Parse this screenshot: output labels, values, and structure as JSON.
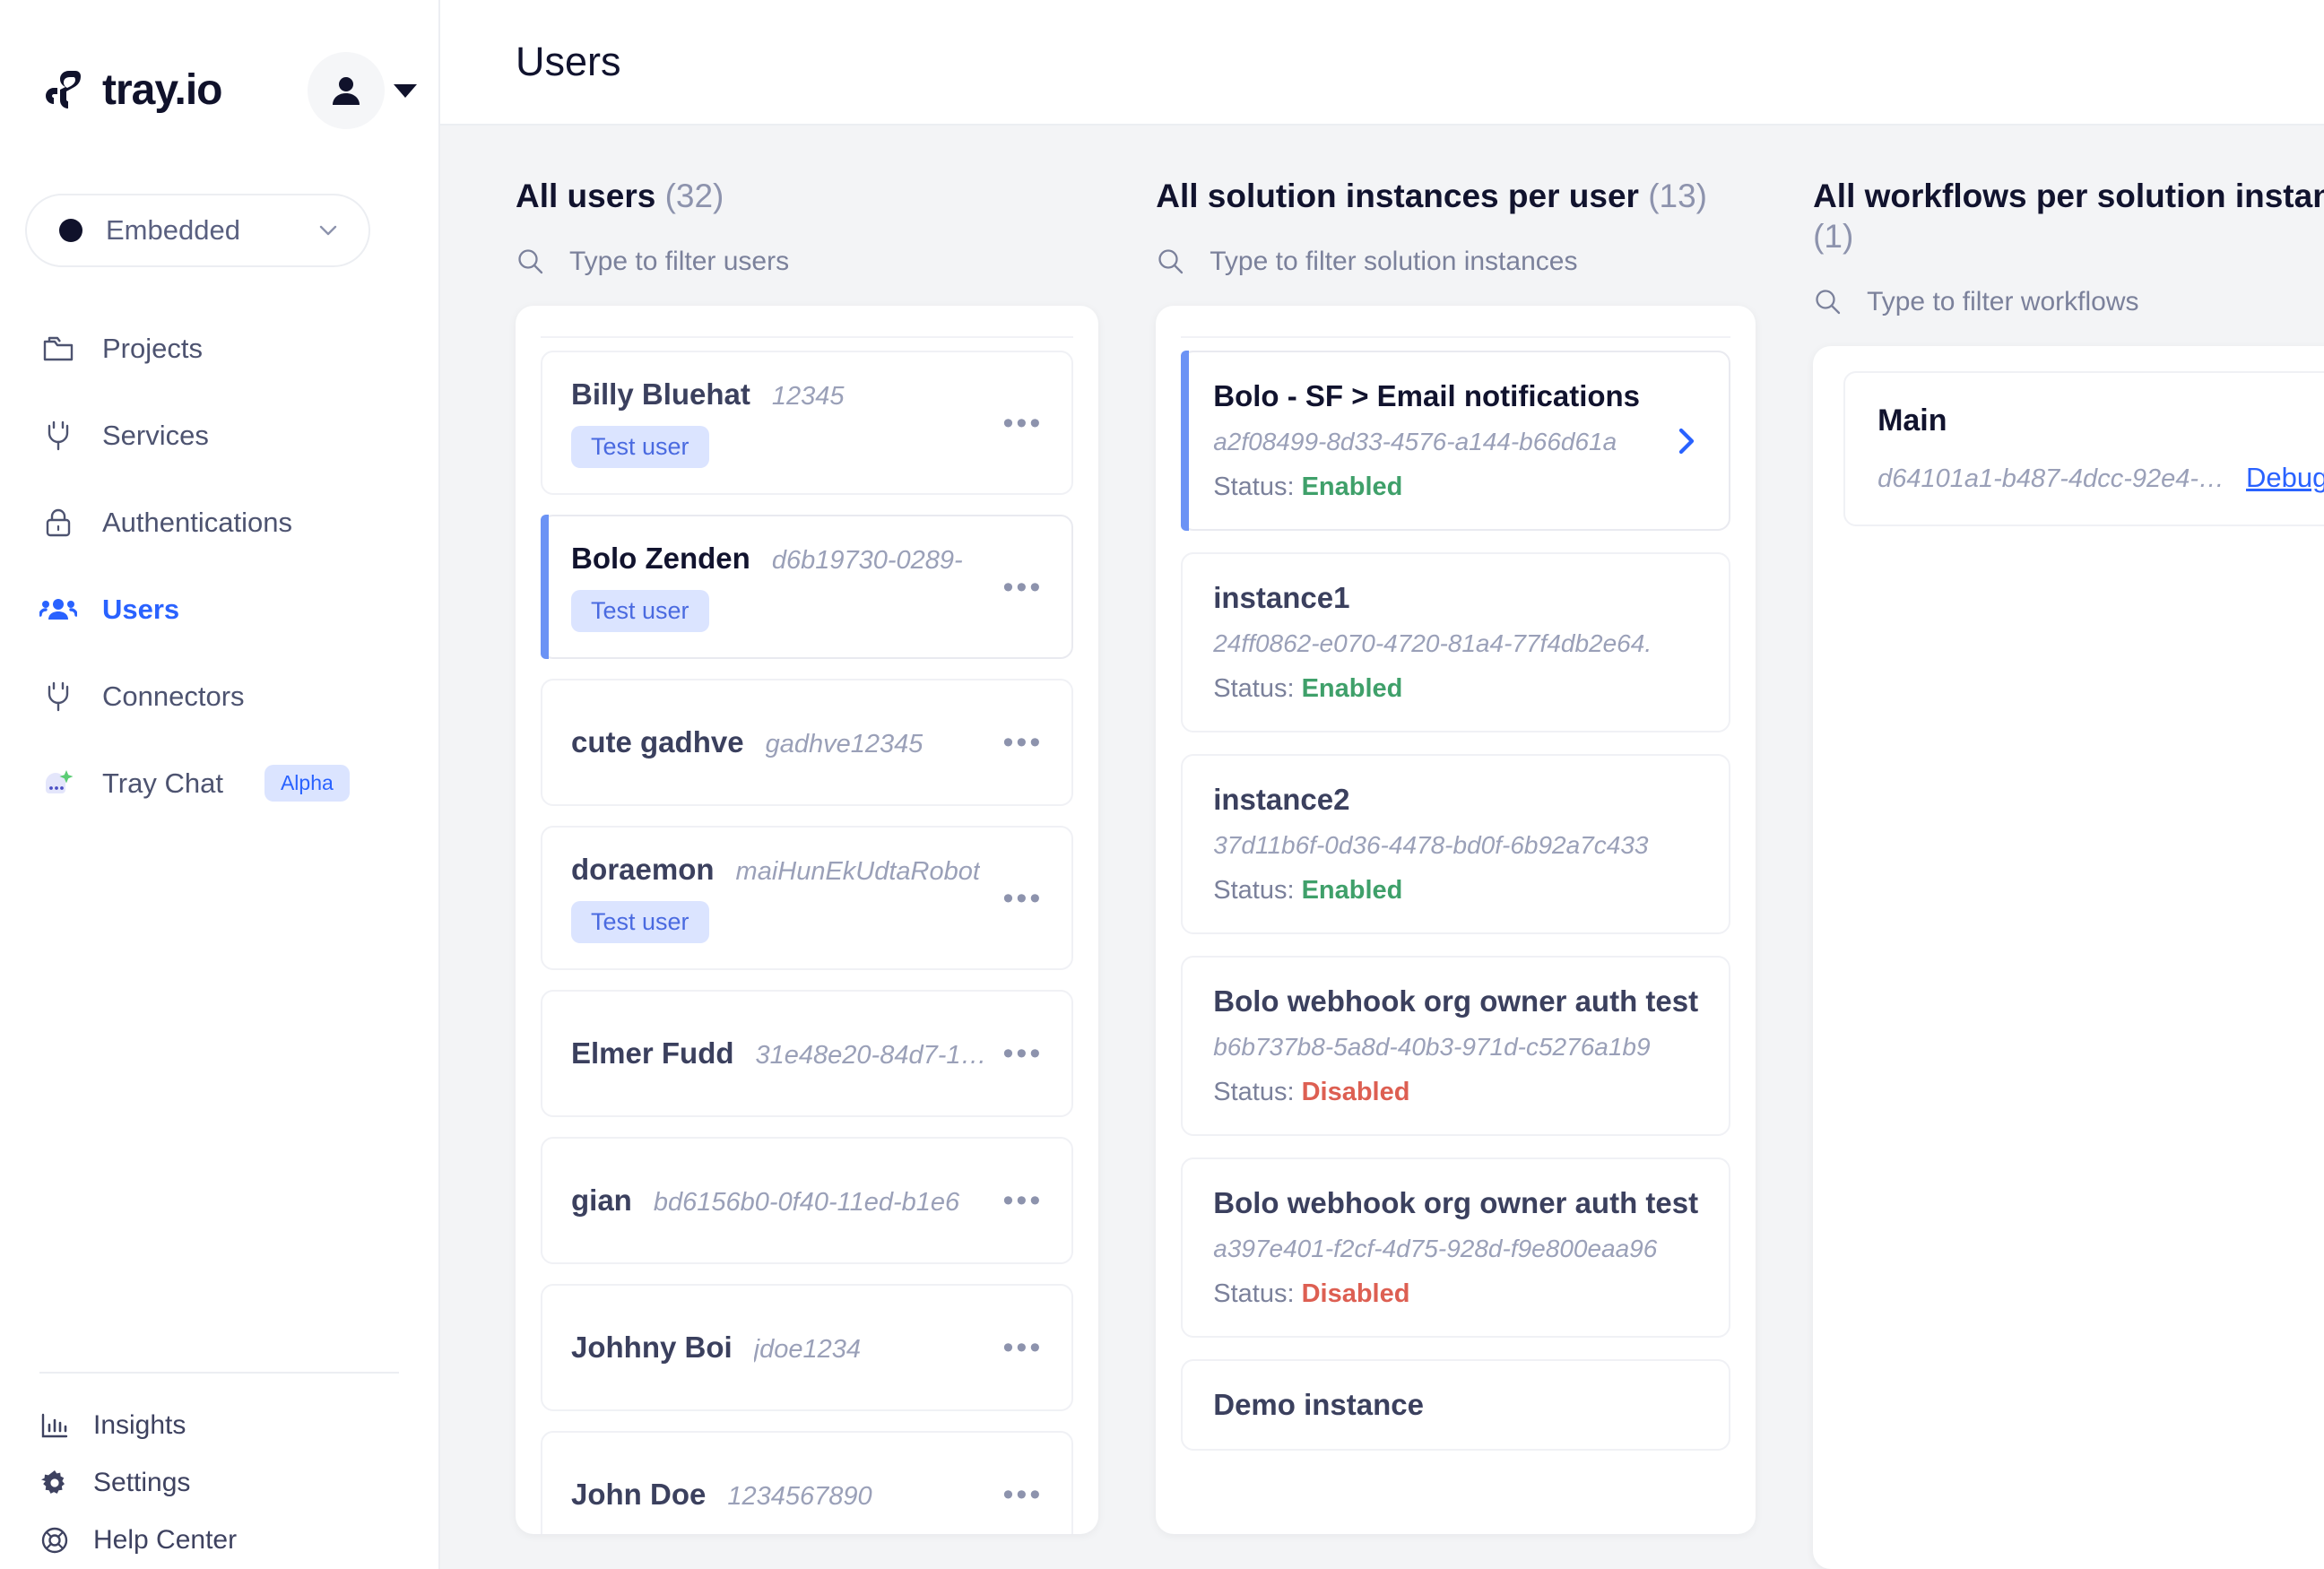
{
  "brand": {
    "name": "tray.io",
    "logo_icon": "tray-logo-icon"
  },
  "account": {
    "avatar_icon": "user-avatar-icon",
    "caret_icon": "chevron-down-icon"
  },
  "environment": {
    "label": "Embedded",
    "dot_color": "#10122b",
    "chevron_icon": "chevron-down-icon"
  },
  "sidebar": {
    "items": [
      {
        "label": "Projects",
        "icon": "folders-icon",
        "active": false
      },
      {
        "label": "Services",
        "icon": "plug-icon",
        "active": false
      },
      {
        "label": "Authentications",
        "icon": "lock-icon",
        "active": false
      },
      {
        "label": "Users",
        "icon": "users-icon",
        "active": true
      },
      {
        "label": "Connectors",
        "icon": "plug-icon",
        "active": false
      },
      {
        "label": "Tray Chat",
        "icon": "tray-chat-sparkle-icon",
        "active": false,
        "badge": "Alpha"
      }
    ],
    "bottom_items": [
      {
        "label": "Insights",
        "icon": "bar-chart-icon"
      },
      {
        "label": "Settings",
        "icon": "gear-icon"
      },
      {
        "label": "Help Center",
        "icon": "lifebuoy-icon"
      }
    ]
  },
  "header": {
    "title": "Users"
  },
  "accent_color": "#2962ff",
  "columns": {
    "users": {
      "title": "All users",
      "count": "(32)",
      "search": {
        "placeholder": "Type to filter users",
        "value": "",
        "icon": "search-icon"
      },
      "items": [
        {
          "name": "Billy Bluehat",
          "id": "12345",
          "tag": "Test user",
          "selected": false,
          "menu": "•••"
        },
        {
          "name": "Bolo Zenden",
          "id": "d6b19730-0289-",
          "tag": "Test user",
          "selected": true,
          "menu": "•••"
        },
        {
          "name": "cute gadhve",
          "id": "gadhve12345",
          "tag": "",
          "selected": false,
          "menu": "•••"
        },
        {
          "name": "doraemon",
          "id": "maiHunEkUdtaRobot",
          "tag": "Test user",
          "selected": false,
          "menu": "•••"
        },
        {
          "name": "Elmer Fudd",
          "id": "31e48e20-84d7-1…",
          "tag": "",
          "selected": false,
          "menu": "•••"
        },
        {
          "name": "gian",
          "id": "bd6156b0-0f40-11ed-b1e6",
          "tag": "",
          "selected": false,
          "menu": "•••"
        },
        {
          "name": "Johhny Boi",
          "id": "jdoe1234",
          "tag": "",
          "selected": false,
          "menu": "•••"
        },
        {
          "name": "John Doe",
          "id": "1234567890",
          "tag": "",
          "selected": false,
          "menu": "•••"
        }
      ]
    },
    "instances": {
      "title": "All solution instances per user",
      "count": "(13)",
      "search": {
        "placeholder": "Type to filter solution instances",
        "value": "",
        "icon": "search-icon"
      },
      "status_label": "Status:",
      "items": [
        {
          "name": "Bolo - SF > Email notifications",
          "id": "a2f08499-8d33-4576-a144-b66d61a",
          "status": "Enabled",
          "selected": true
        },
        {
          "name": "instance1",
          "id": "24ff0862-e070-4720-81a4-77f4db2e64.",
          "status": "Enabled",
          "selected": false
        },
        {
          "name": "instance2",
          "id": "37d11b6f-0d36-4478-bd0f-6b92a7c433",
          "status": "Enabled",
          "selected": false
        },
        {
          "name": "Bolo webhook org owner auth test",
          "id": "b6b737b8-5a8d-40b3-971d-c5276a1b9",
          "status": "Disabled",
          "selected": false
        },
        {
          "name": "Bolo webhook org owner auth test",
          "id": "a397e401-f2cf-4d75-928d-f9e800eaa96",
          "status": "Disabled",
          "selected": false
        },
        {
          "name": "Demo instance",
          "id": "",
          "status": "",
          "selected": false
        }
      ]
    },
    "workflows": {
      "title": "All workflows per solution instance",
      "count": "(1)",
      "search": {
        "placeholder": "Type to filter workflows",
        "value": "",
        "icon": "search-icon"
      },
      "items": [
        {
          "name": "Main",
          "id": "d64101a1-b487-4dcc-92e4-…",
          "action": "Debug"
        }
      ]
    }
  }
}
